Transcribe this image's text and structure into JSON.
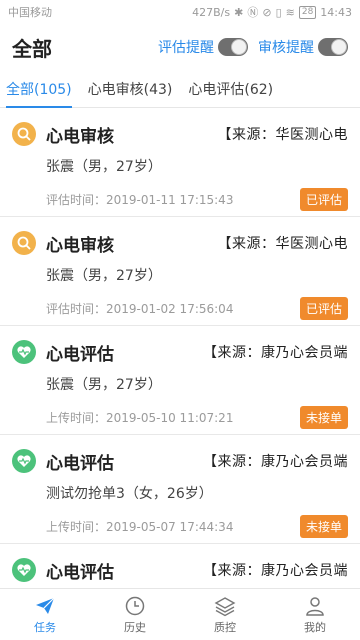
{
  "statusbar": {
    "carrier": "中国移动",
    "netspeed": "427B/s",
    "battery": "28",
    "time": "14:43"
  },
  "header": {
    "title": "全部",
    "eval_toggle_label": "评估提醒",
    "review_toggle_label": "审核提醒"
  },
  "tabs": [
    {
      "label": "全部(105)"
    },
    {
      "label": "心电审核(43)"
    },
    {
      "label": "心电评估(62)"
    }
  ],
  "cards": [
    {
      "title": "心电审核",
      "source": "【来源：华医测心电",
      "patient": "张震（男，27岁）",
      "time": "评估时间：2019-01-11 17:15:43",
      "status": "已评估"
    },
    {
      "title": "心电审核",
      "source": "【来源：华医测心电",
      "patient": "张震（男，27岁）",
      "time": "评估时间：2019-01-02 17:56:04",
      "status": "已评估"
    },
    {
      "title": "心电评估",
      "source": "【来源：康乃心会员端",
      "patient": "张震（男，27岁）",
      "time": "上传时间：2019-05-10 11:07:21",
      "status": "未接单"
    },
    {
      "title": "心电评估",
      "source": "【来源：康乃心会员端",
      "patient": "测试勿抢单3（女，26岁）",
      "time": "上传时间：2019-05-07 17:44:34",
      "status": "未接单"
    },
    {
      "title": "心电评估",
      "source": "【来源：康乃心会员端",
      "patient": "",
      "time": "",
      "status": ""
    }
  ],
  "nav": [
    {
      "label": "任务"
    },
    {
      "label": "历史"
    },
    {
      "label": "质控"
    },
    {
      "label": "我的"
    }
  ],
  "colors": {
    "accent": "#2a8ae8",
    "orange_icon": "#f2b24b",
    "green_icon": "#4cc27b",
    "status_tag": "#f08a2c"
  }
}
